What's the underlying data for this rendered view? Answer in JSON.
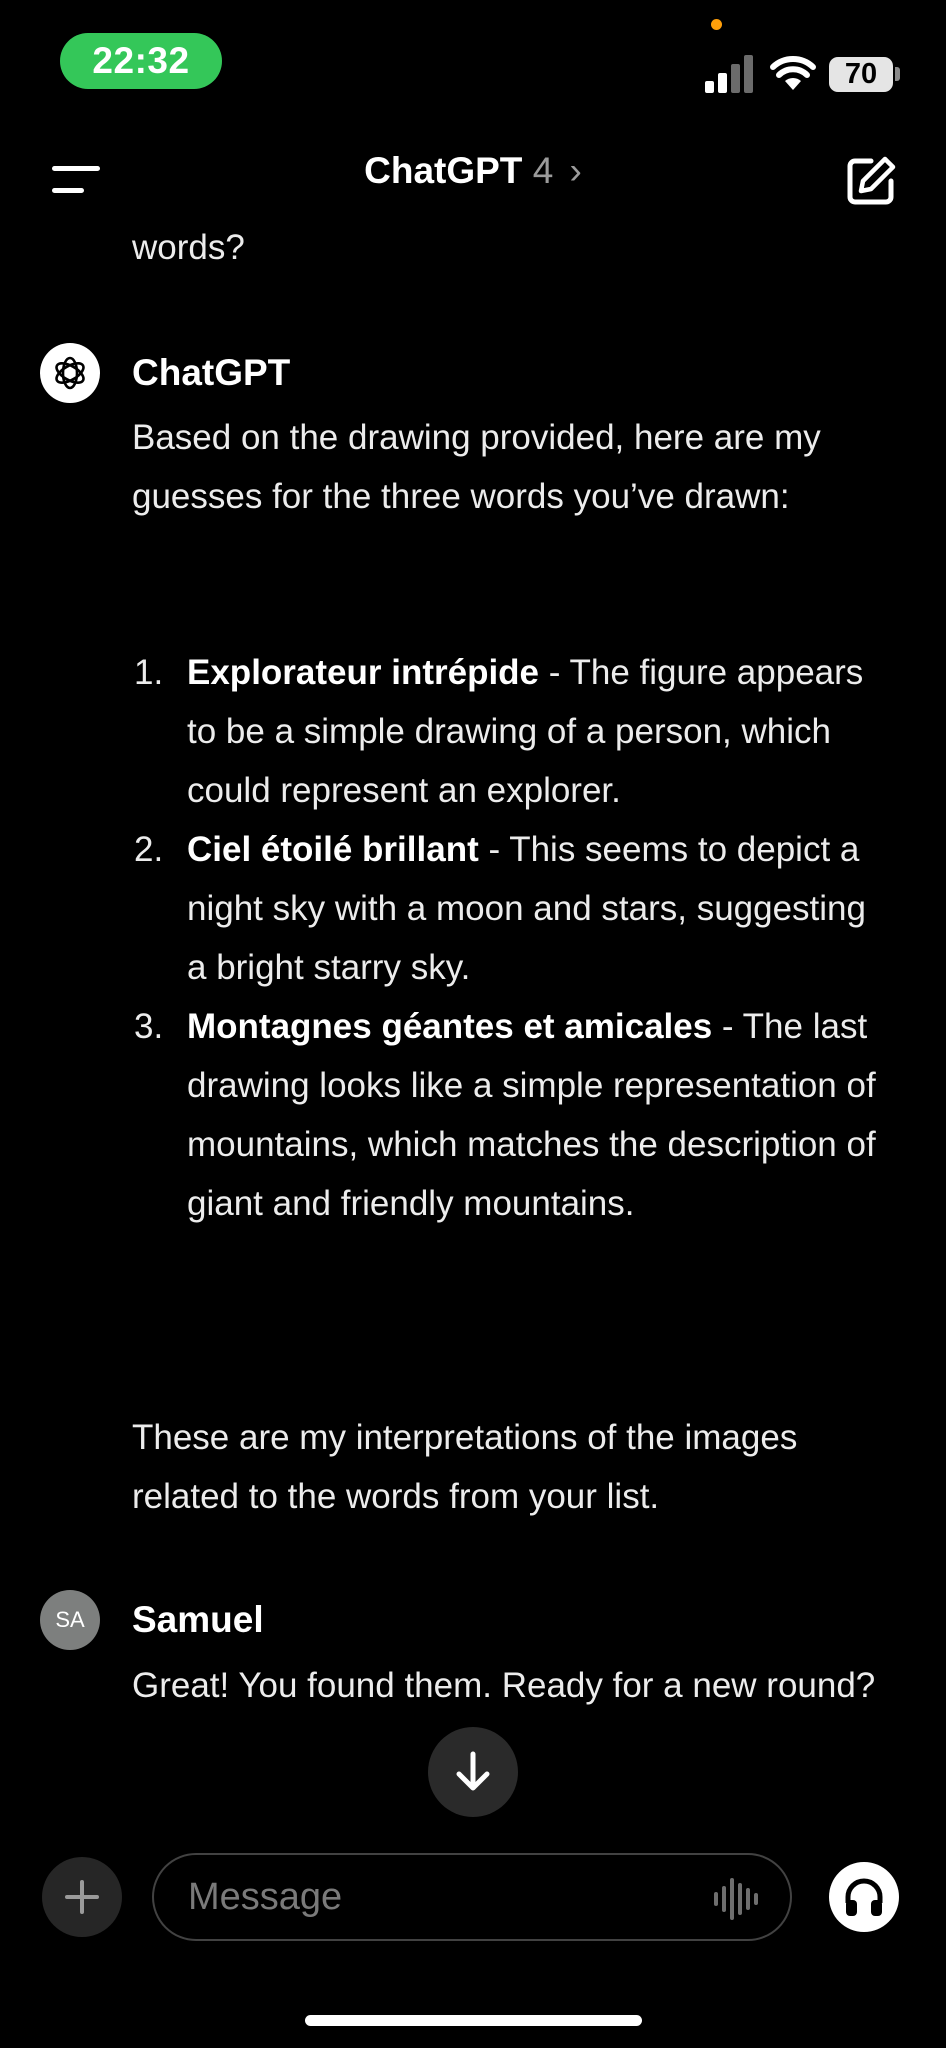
{
  "status_bar": {
    "time": "22:32",
    "battery_level": "70",
    "time_pill_color": "#34c759",
    "icons": [
      "signal-icon",
      "wifi-icon",
      "battery-icon"
    ]
  },
  "nav": {
    "title": "ChatGPT",
    "model_version": "4",
    "chevron": "›",
    "icons": [
      "menu-icon",
      "compose-icon"
    ]
  },
  "conversation": {
    "previous_tail": "words?",
    "assistant": {
      "name": "ChatGPT",
      "intro": "Based on the drawing provided, here are my guesses for the three words you’ve drawn:",
      "items": [
        {
          "number": "1.",
          "title": "Explorateur intrépide",
          "text": " - The figure appears to be a simple drawing of a person, which could represent an explorer."
        },
        {
          "number": "2.",
          "title": "Ciel étoilé brillant",
          "text": " - This seems to depict a night sky with a moon and stars, suggesting a bright starry sky."
        },
        {
          "number": "3.",
          "title": "Montagnes géantes et amicales",
          "text": " - The last drawing looks like a simple representation of mountains, which matches the description of giant and friendly mountains."
        }
      ],
      "outro": "These are my interpretations of the images related to the words from your list."
    },
    "user": {
      "name": "Samuel",
      "initials": "SA",
      "message": "Great! You found them. Ready for a new round?"
    }
  },
  "composer": {
    "placeholder": "Message",
    "icons": [
      "plus-icon",
      "waveform-icon",
      "headphones-icon",
      "arrow-down-icon"
    ]
  }
}
